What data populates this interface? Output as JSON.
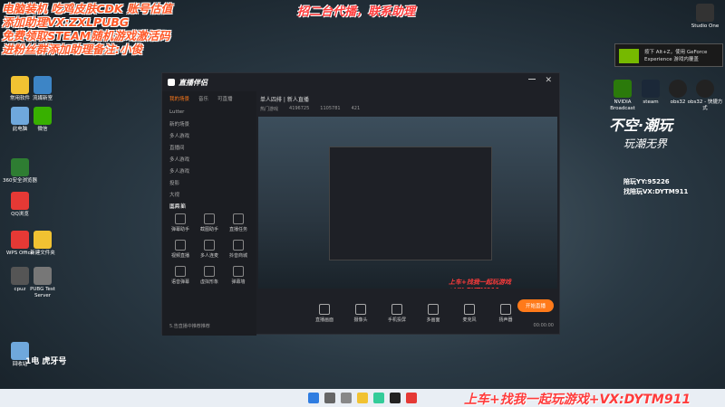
{
  "promo_lines": [
    "电脑装机 吃鸡皮肤CDK 账号估值",
    "添加助理VX:ZXLPUBG",
    "免费领取STEAM随机游戏激活码",
    "进粉丝群添加助理备注:小俊"
  ],
  "top_center_text": "招二台代播，联系助理",
  "desktop_icons": [
    {
      "label": "回收站",
      "color": "#6fa8dc"
    },
    {
      "label": "常用软件",
      "color": "#f1c232"
    },
    {
      "label": "流媒新室",
      "color": "#3d85c6"
    },
    {
      "label": "此电脑",
      "color": "#6fa8dc"
    },
    {
      "label": "微信",
      "color": "#38b000"
    },
    {
      "label": "360安全浏览器",
      "color": "#2e7d32"
    },
    {
      "label": "QQ浏览",
      "color": "#e53935"
    },
    {
      "label": "WPS Office",
      "color": "#e53935"
    },
    {
      "label": "新建文件夹",
      "color": "#f1c232"
    },
    {
      "label": "PUBG Test Server",
      "color": "#777"
    },
    {
      "label": "cpuz",
      "color": "#555"
    }
  ],
  "right_icons": [
    {
      "label": "NVIDIA Broadcast",
      "color": "#2b7a0b"
    },
    {
      "label": "steam",
      "color": "#1b2838"
    },
    {
      "label": "obs32",
      "color": "#222"
    },
    {
      "label": "obs32 - 快捷方式",
      "color": "#222"
    },
    {
      "label": "Studio One",
      "color": "#333"
    }
  ],
  "geforce_hint": "按下 Alt+Z，使用 GeForce Experience 游戏内覆盖",
  "window": {
    "app_title": "直播伴侣",
    "tabs": [
      "我的场景",
      "音乐",
      "可直播"
    ],
    "source_items": [
      "Lutter",
      "新的场景",
      "多人游戏",
      "直播间",
      "多人游戏",
      "多人游戏",
      "投影",
      "大视",
      "图片 1"
    ],
    "tools_title": "工具箱",
    "tools": [
      "弹幕助手",
      "截图助手",
      "直播任务",
      "视频直播",
      "多人连麦",
      "抖音商城",
      "语音弹幕",
      "虚拟形象",
      "弹幕墙"
    ],
    "status_text": "5.告直播中推荐推荐",
    "user_name": "单人四排 | 新人直播",
    "stats": [
      "热门游戏",
      "4196725",
      "1105781",
      "421"
    ],
    "controls": [
      "直播画面",
      "摄像头",
      "手机投屏",
      "多画面",
      "麦克风",
      "扬声器"
    ],
    "start_button": "开始直播",
    "timer": "00:00:00"
  },
  "brand_title": "不空·潮玩",
  "brand_subtitle": "玩潮无界",
  "contacts": [
    "陪玩YY:95226",
    "找陪玩VX:DYTM911"
  ],
  "bottom_promo": "上车+找我一起玩游戏+VX:DYTM911",
  "preview_promo": "上车+找我一起玩游戏+VX:DYTM911",
  "watermark": "1电 虎牙号"
}
